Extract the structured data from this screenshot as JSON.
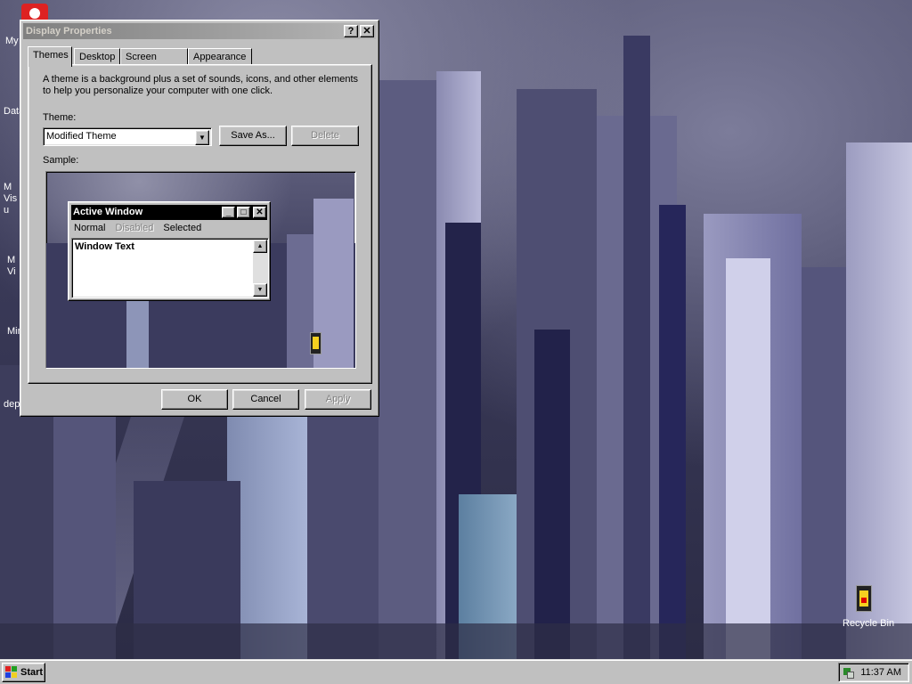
{
  "desktop": {
    "icons": [
      {
        "label": "My",
        "icon": "my-computer-icon"
      },
      {
        "label": "Data",
        "icon": "data-icon"
      },
      {
        "label": "M Visu",
        "icon": "visual-icon"
      },
      {
        "label": "M Vi",
        "icon": "visual2-icon"
      },
      {
        "label": "Min",
        "icon": "minesweeper-icon"
      },
      {
        "label": "dep",
        "icon": "dep-icon"
      }
    ],
    "recycle_bin": {
      "label": "Recycle Bin",
      "icon": "recycle-bin-icon"
    }
  },
  "dialog": {
    "title": "Display Properties",
    "help_button": "?",
    "close_button": "✕",
    "tabs": [
      {
        "label": "Themes",
        "active": true
      },
      {
        "label": "Desktop",
        "active": false
      },
      {
        "label": "Screen Saver",
        "active": false
      },
      {
        "label": "Appearance",
        "active": false
      }
    ],
    "description": "A theme is a background plus a set of sounds, icons, and other elements to help you personalize your computer with one click.",
    "theme_label": "Theme:",
    "theme_value": "Modified Theme",
    "save_as_label": "Save As...",
    "delete_label": "Delete",
    "sample_label": "Sample:",
    "sample": {
      "window_title": "Active Window",
      "menu": {
        "normal": "Normal",
        "disabled": "Disabled",
        "selected": "Selected"
      },
      "window_text": "Window Text"
    },
    "ok_label": "OK",
    "cancel_label": "Cancel",
    "apply_label": "Apply"
  },
  "taskbar": {
    "start_label": "Start",
    "clock": "11:37 AM"
  },
  "colors": {
    "face": "#c0c0c0",
    "inactive_title": "#808080",
    "sample_title": "#000000"
  }
}
